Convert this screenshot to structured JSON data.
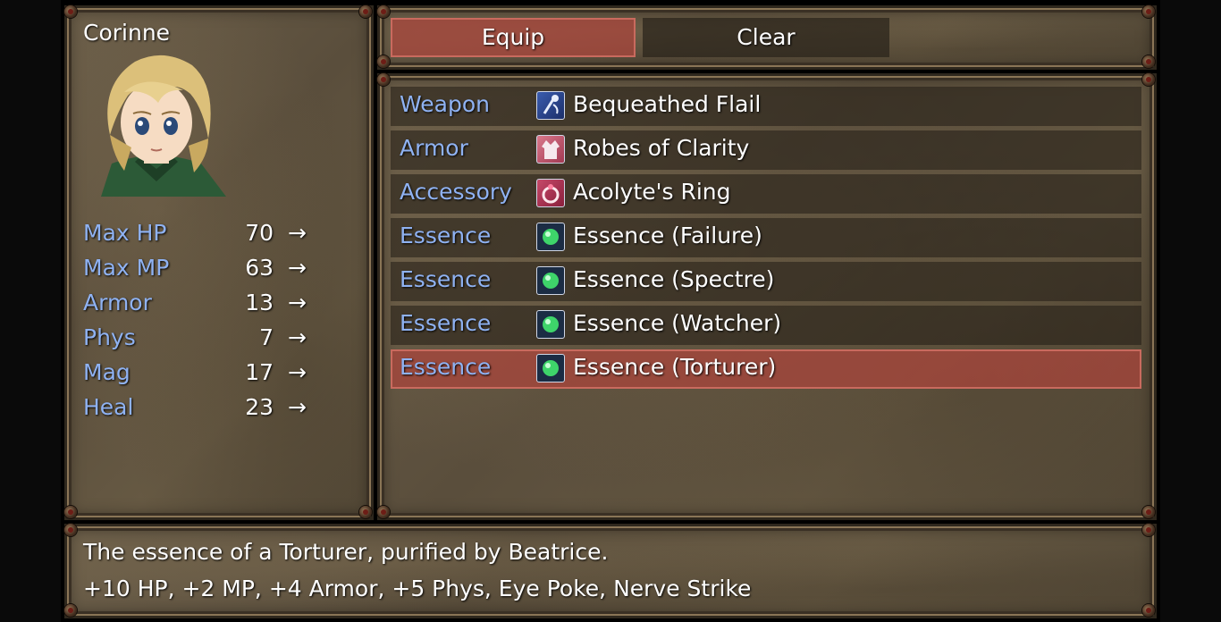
{
  "actor": {
    "name": "Corinne",
    "portrait_icon": "blonde-character-portrait"
  },
  "stats": [
    {
      "label": "Max HP",
      "value": "70",
      "arrow": "→"
    },
    {
      "label": "Max MP",
      "value": "63",
      "arrow": "→"
    },
    {
      "label": "Armor",
      "value": "13",
      "arrow": "→"
    },
    {
      "label": "Phys",
      "value": "7",
      "arrow": "→"
    },
    {
      "label": "Mag",
      "value": "17",
      "arrow": "→"
    },
    {
      "label": "Heal",
      "value": "23",
      "arrow": "→"
    }
  ],
  "commands": {
    "equip_label": "Equip",
    "clear_label": "Clear",
    "selected": "Equip"
  },
  "slots": [
    {
      "type": "Weapon",
      "item": "Bequeathed Flail",
      "icon": "flail-icon"
    },
    {
      "type": "Armor",
      "item": "Robes of Clarity",
      "icon": "robe-icon"
    },
    {
      "type": "Accessory",
      "item": "Acolyte's Ring",
      "icon": "ring-icon"
    },
    {
      "type": "Essence",
      "item": "Essence (Failure)",
      "icon": "green-orb-icon"
    },
    {
      "type": "Essence",
      "item": "Essence (Spectre)",
      "icon": "green-orb-icon"
    },
    {
      "type": "Essence",
      "item": "Essence (Watcher)",
      "icon": "green-orb-icon"
    },
    {
      "type": "Essence",
      "item": "Essence (Torturer)",
      "icon": "green-orb-icon"
    }
  ],
  "selected_slot_index": 6,
  "help": {
    "line1": "The essence of a Torturer, purified by Beatrice.",
    "line2": "+10 HP, +2 MP, +4 Armor, +5 Phys, Eye Poke, Nerve Strike"
  },
  "colors": {
    "label_blue": "#8fb2f2",
    "selection_red": "#aa463c",
    "window_brown": "#5f533f"
  }
}
